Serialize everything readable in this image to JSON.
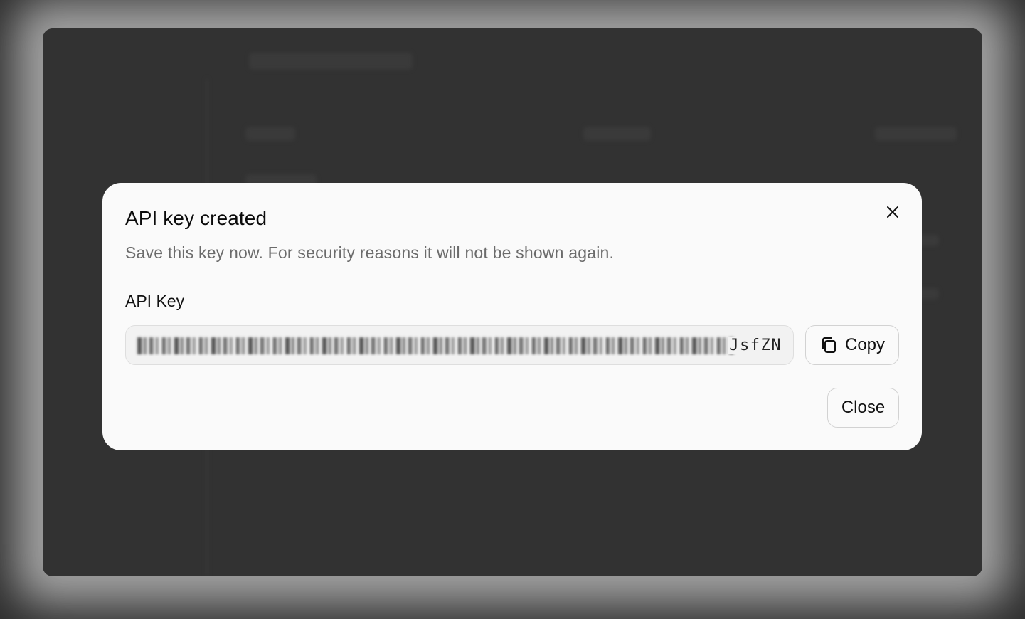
{
  "dialog": {
    "title": "API key created",
    "description": "Save this key now. For security reasons it will not be shown again.",
    "field_label": "API Key",
    "key_visible_tail": "JsfZN",
    "copy_label": "Copy",
    "close_label": "Close"
  },
  "icons": {
    "close": "close-icon",
    "copy": "copy-icon"
  },
  "colors": {
    "backdrop": "#2f2f2f",
    "dialog_bg": "#fafafa",
    "text_primary": "#0b0b0b",
    "text_muted": "#6b6b6b",
    "border": "#d2d2d2"
  }
}
